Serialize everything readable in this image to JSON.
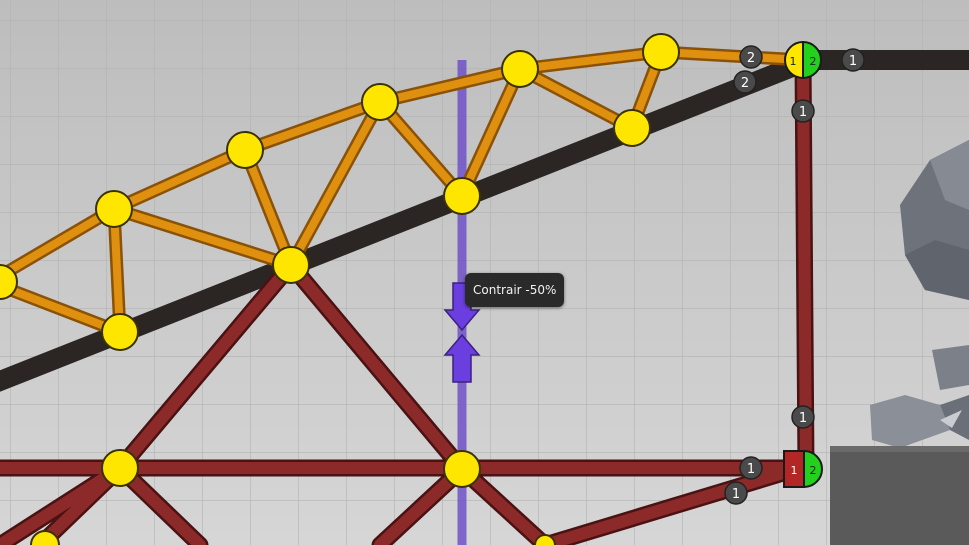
{
  "tooltip": {
    "text": "Contrair -50%"
  },
  "colors": {
    "background": "#c9c9c9",
    "grid_line": "#b4b4b4",
    "wood": "#e0900f",
    "wood_edge": "#8a5206",
    "steel": "#8c2a2a",
    "steel_edge": "#4a1111",
    "road": "#2a2424",
    "joint": "#ffe600",
    "anchor_green": "#21d11c",
    "hydraulic_guide": "#7b5cc8",
    "hydraulic_arrow": "#6b3ee0",
    "terrain": "#5a5a5a",
    "rock": "#747983"
  },
  "badges": [
    {
      "label": "2"
    },
    {
      "label": "2"
    },
    {
      "label": "1"
    },
    {
      "label": "1"
    },
    {
      "label": "1"
    },
    {
      "label": "1"
    },
    {
      "label": "1"
    }
  ],
  "anchors": [
    {
      "left_label": "1",
      "right_label": "2",
      "left_color": "#ffe600"
    },
    {
      "left_label": "1",
      "right_label": "2",
      "left_color": "#b22626"
    }
  ],
  "icons": {
    "hydraulic_up": "arrow-up-icon",
    "hydraulic_down": "arrow-down-icon"
  }
}
